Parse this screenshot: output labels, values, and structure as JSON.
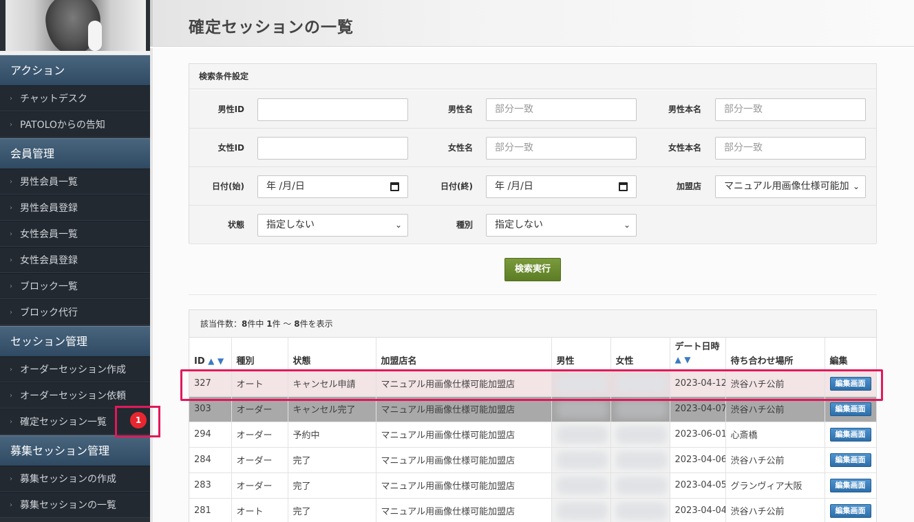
{
  "sidebar": {
    "sections": [
      {
        "label": "アクション",
        "items": [
          "チャットデスク",
          "PATOLOからの告知"
        ]
      },
      {
        "label": "会員管理",
        "items": [
          "男性会員一覧",
          "男性会員登録",
          "女性会員一覧",
          "女性会員登録",
          "ブロック一覧",
          "ブロック代行"
        ]
      },
      {
        "label": "セッション管理",
        "items": [
          "オーダーセッション作成",
          "オーダーセッション依頼",
          "確定セッション一覧"
        ]
      },
      {
        "label": "募集セッション管理",
        "items": [
          "募集セッションの作成",
          "募集セッションの一覧"
        ]
      }
    ]
  },
  "page": {
    "title": "確定セッションの一覧"
  },
  "search": {
    "heading": "検索条件設定",
    "fields": {
      "male_id": {
        "label": "男性ID",
        "value": ""
      },
      "male_name": {
        "label": "男性名",
        "placeholder": "部分一致"
      },
      "male_real_name": {
        "label": "男性本名",
        "placeholder": "部分一致"
      },
      "female_id": {
        "label": "女性ID",
        "value": ""
      },
      "female_name": {
        "label": "女性名",
        "placeholder": "部分一致"
      },
      "female_real_name": {
        "label": "女性本名",
        "placeholder": "部分一致"
      },
      "date_start": {
        "label": "日付(始)",
        "value": "年 /月/日"
      },
      "date_end": {
        "label": "日付(終)",
        "value": "年 /月/日"
      },
      "store": {
        "label": "加盟店",
        "value": "マニュアル用画像仕様可能加"
      },
      "status": {
        "label": "状態",
        "value": "指定しない"
      },
      "kind": {
        "label": "種別",
        "value": "指定しない"
      }
    },
    "submit_label": "検索実行"
  },
  "results": {
    "summary_prefix": "該当件数：",
    "summary_total": "8",
    "summary_mid1": "件中 ",
    "summary_from": "1",
    "summary_mid2": "件 〜 ",
    "summary_to": "8",
    "summary_suffix": "件を表示",
    "columns": {
      "id": "ID",
      "kind": "種別",
      "status": "状態",
      "store": "加盟店名",
      "male": "男性",
      "female": "女性",
      "date": "デート日時",
      "place": "待ち合わせ場所",
      "edit": "編集"
    },
    "sort_asc": "▲",
    "sort_desc": "▼",
    "edit_label": "編集画面",
    "rows": [
      {
        "id": "327",
        "kind": "オート",
        "status": "キャンセル申請",
        "store": "マニュアル用画像仕様可能加盟店",
        "date": "2023-04-12",
        "place": "渋谷ハチ公前"
      },
      {
        "id": "303",
        "kind": "オーダー",
        "status": "キャンセル完了",
        "store": "マニュアル用画像仕様可能加盟店",
        "date": "2023-04-07",
        "place": "渋谷ハチ公前"
      },
      {
        "id": "294",
        "kind": "オーダー",
        "status": "予約中",
        "store": "マニュアル用画像仕様可能加盟店",
        "date": "2023-06-01",
        "place": "心斎橋"
      },
      {
        "id": "284",
        "kind": "オーダー",
        "status": "完了",
        "store": "マニュアル用画像仕様可能加盟店",
        "date": "2023-04-06",
        "place": "渋谷ハチ公前"
      },
      {
        "id": "283",
        "kind": "オーダー",
        "status": "完了",
        "store": "マニュアル用画像仕様可能加盟店",
        "date": "2023-04-05",
        "place": "グランヴィア大阪"
      },
      {
        "id": "281",
        "kind": "オート",
        "status": "完了",
        "store": "マニュアル用画像仕様可能加盟店",
        "date": "2023-04-04",
        "place": "渋谷ハチ公前"
      }
    ]
  },
  "annotation": {
    "step_number": "1",
    "highlight_color": "#e2185a"
  }
}
